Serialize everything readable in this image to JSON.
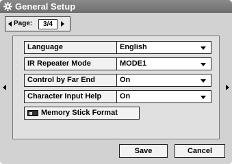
{
  "title": "General Setup",
  "page": {
    "label": "Page:",
    "value": "3/4"
  },
  "settings": [
    {
      "label": "Language",
      "value": "English"
    },
    {
      "label": "IR Repeater Mode",
      "value": "MODE1"
    },
    {
      "label": "Control by Far End",
      "value": "On"
    },
    {
      "label": "Character Input Help",
      "value": "On"
    }
  ],
  "memory_stick_button": "Memory Stick Format",
  "buttons": {
    "save": "Save",
    "cancel": "Cancel"
  },
  "icons": {
    "title": "gear-icon",
    "page_prev": "triangle-left-icon",
    "page_next": "triangle-right-icon",
    "memory_stick": "memory-stick-icon",
    "nav_prev": "triangle-left-icon",
    "nav_next": "triangle-right-icon"
  }
}
